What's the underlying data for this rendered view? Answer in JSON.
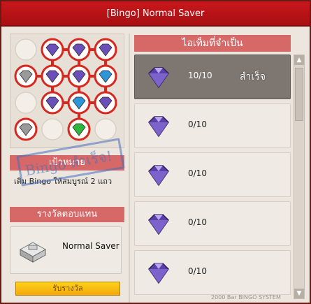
{
  "window": {
    "title": "[Bingo] Normal Saver",
    "close_glyph": "✕"
  },
  "board": {
    "grid": [
      [
        "empty",
        "purple",
        "purple",
        "purple"
      ],
      [
        "silver",
        "purple",
        "purple",
        "blue"
      ],
      [
        "empty",
        "purple",
        "blue",
        "purple"
      ],
      [
        "silver",
        "empty",
        "green",
        "empty"
      ]
    ],
    "colors": {
      "purple": "#6a4fb8",
      "blue": "#2e95d6",
      "green": "#2fb63c",
      "silver": "#9a9a9a",
      "highlight": "#d6281f"
    }
  },
  "goal": {
    "header": "เป้าหมาย",
    "text": "เติม Bingo ให้สมบูรณ์ 2 แถว",
    "stamp": "Bingo สำเร็จ!"
  },
  "reward": {
    "header": "รางวัลตอบแทน",
    "name": "Normal Saver",
    "icon": "silver-saver-icon",
    "claim_label": "รับรางวัล"
  },
  "requirements": {
    "header": "ไอเท็มที่จำเป็น",
    "items": [
      {
        "count": "10/10",
        "status": "done",
        "stamp": "สำเร็จ"
      },
      {
        "count": "0/10",
        "status": "pending"
      },
      {
        "count": "0/10",
        "status": "pending"
      },
      {
        "count": "0/10",
        "status": "pending"
      },
      {
        "count": "0/10",
        "status": "pending"
      }
    ]
  },
  "scroll": {
    "up": "▲",
    "down": "▼"
  },
  "watermark": "2000 Bar BINGO SYSTEM"
}
